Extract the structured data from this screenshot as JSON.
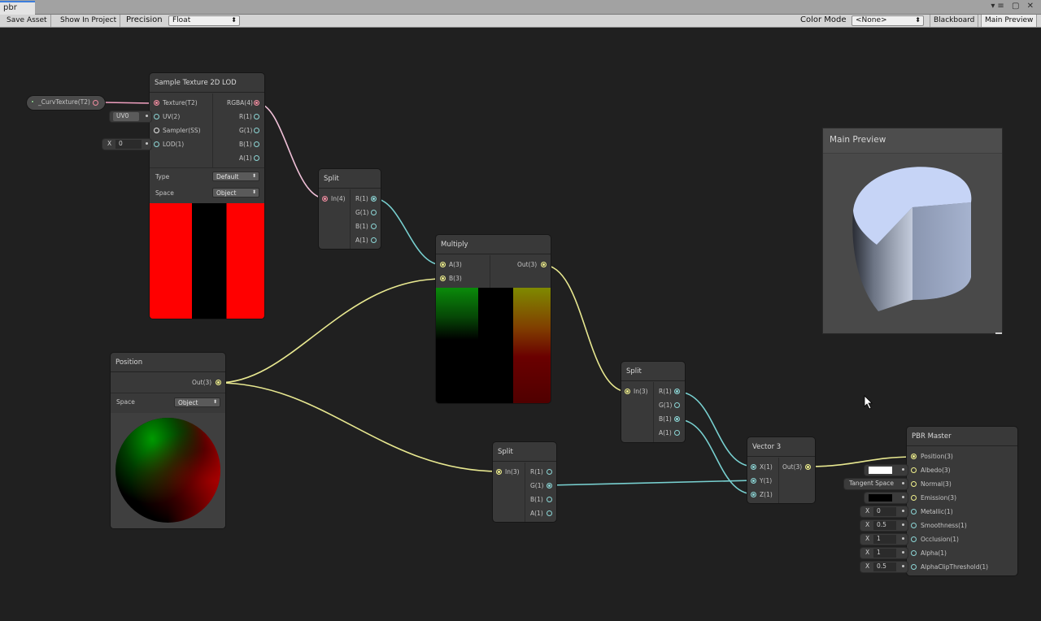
{
  "window": {
    "tab_title": "pbr"
  },
  "toolbar": {
    "save_asset": "Save Asset",
    "show_in_project": "Show In Project",
    "precision_label": "Precision",
    "precision_value": "Float",
    "color_mode_label": "Color Mode",
    "color_mode_value": "<None>",
    "blackboard": "Blackboard",
    "main_preview": "Main Preview"
  },
  "property_node": {
    "label": "_CurvTexture(T2)"
  },
  "nodes": {
    "sample_texture": {
      "title": "Sample Texture 2D LOD",
      "inputs": [
        "Texture(T2)",
        "UV(2)",
        "Sampler(SS)",
        "LOD(1)"
      ],
      "outputs": [
        "RGBA(4)",
        "R(1)",
        "G(1)",
        "B(1)",
        "A(1)"
      ],
      "type_label": "Type",
      "type_value": "Default",
      "space_label": "Space",
      "space_value": "Object"
    },
    "uv_chip": {
      "value": "UV0"
    },
    "lod_chip": {
      "key": "X",
      "value": "0"
    },
    "split1": {
      "title": "Split",
      "input": "In(4)",
      "outputs": [
        "R(1)",
        "G(1)",
        "B(1)",
        "A(1)"
      ]
    },
    "multiply": {
      "title": "Multiply",
      "inputs": [
        "A(3)",
        "B(3)"
      ],
      "output": "Out(3)"
    },
    "position": {
      "title": "Position",
      "output": "Out(3)",
      "space_label": "Space",
      "space_value": "Object"
    },
    "split2": {
      "title": "Split",
      "input": "In(3)",
      "outputs": [
        "R(1)",
        "G(1)",
        "B(1)",
        "A(1)"
      ]
    },
    "split3": {
      "title": "Split",
      "input": "In(3)",
      "outputs": [
        "R(1)",
        "G(1)",
        "B(1)",
        "A(1)"
      ]
    },
    "vector3": {
      "title": "Vector 3",
      "inputs": [
        "X(1)",
        "Y(1)",
        "Z(1)"
      ],
      "output": "Out(3)"
    },
    "pbr_master": {
      "title": "PBR Master",
      "inputs": [
        "Position(3)",
        "Albedo(3)",
        "Normal(3)",
        "Emission(3)",
        "Metallic(1)",
        "Smoothness(1)",
        "Occlusion(1)",
        "Alpha(1)",
        "AlphaClipThreshold(1)"
      ]
    },
    "pbr_chips": {
      "normal": "Tangent Space",
      "metallic_key": "X",
      "metallic": "0",
      "smoothness_key": "X",
      "smoothness": "0.5",
      "occlusion_key": "X",
      "occlusion": "1",
      "alpha_key": "X",
      "alpha": "1",
      "clip_key": "X",
      "clip": "0.5"
    }
  },
  "main_preview": {
    "title": "Main Preview"
  },
  "colors": {
    "wire_yellow": "#e8e890",
    "wire_cyan": "#78d0d0",
    "wire_pink": "#f0a0c0",
    "canvas": "#202020",
    "node": "#393939"
  }
}
